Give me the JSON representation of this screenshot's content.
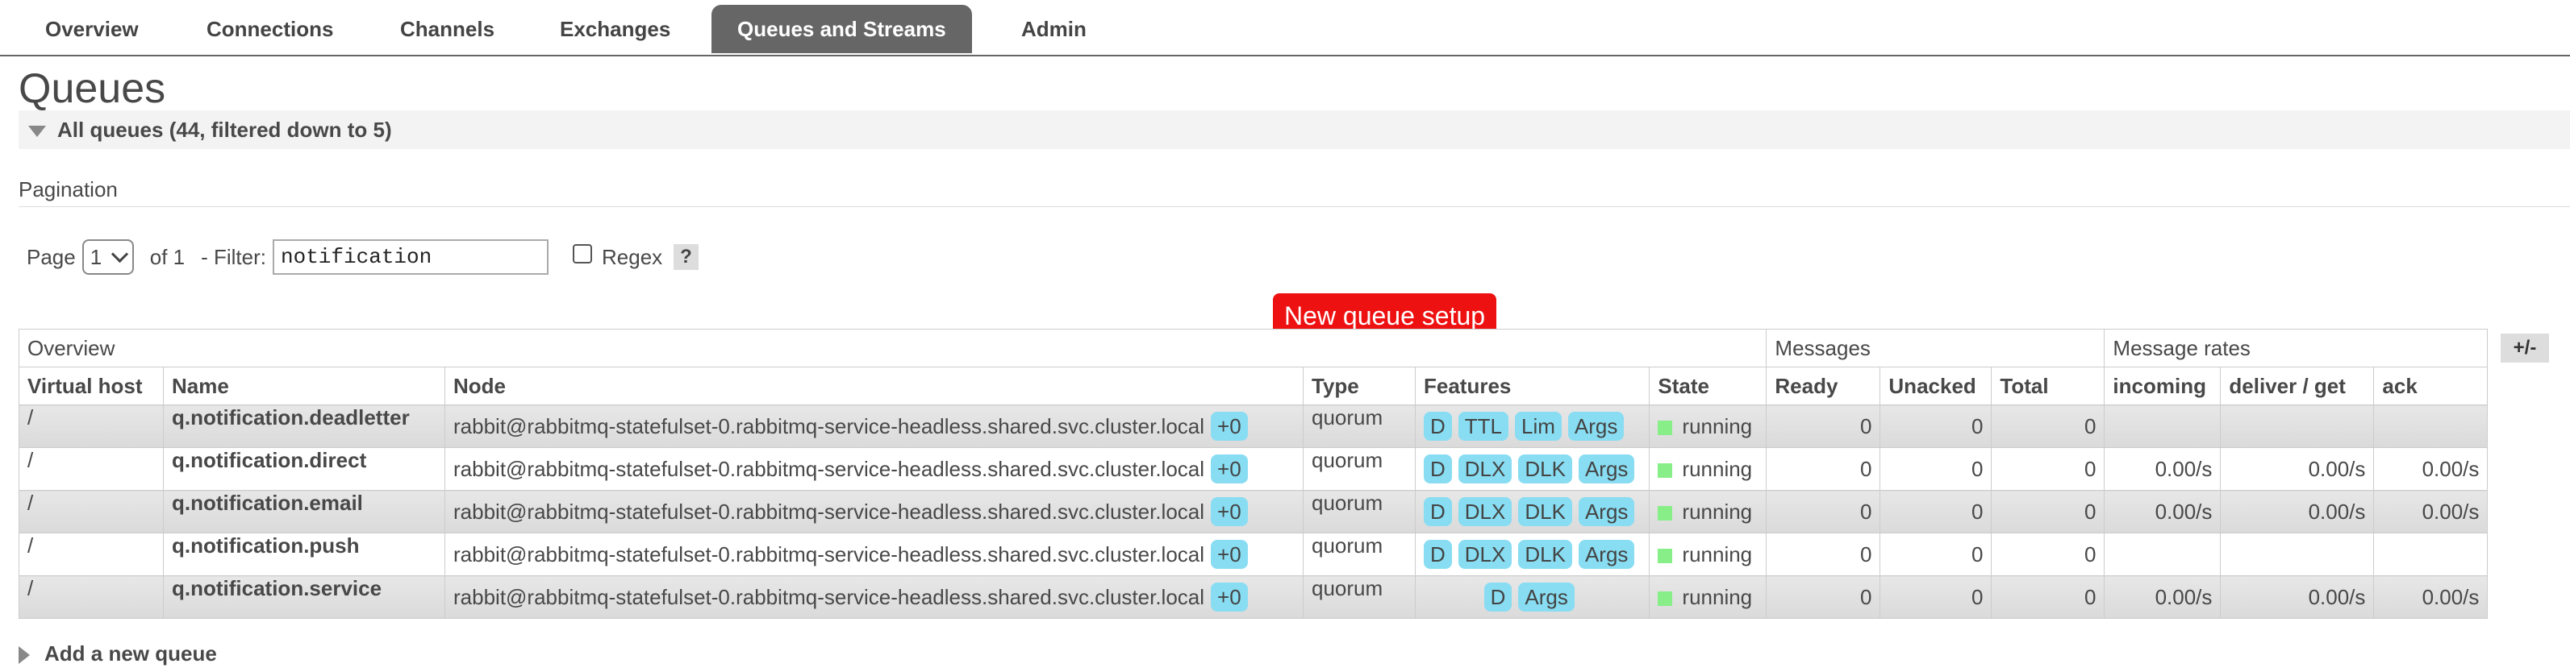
{
  "nav": {
    "tabs": [
      {
        "label": "Overview"
      },
      {
        "label": "Connections"
      },
      {
        "label": "Channels"
      },
      {
        "label": "Exchanges"
      },
      {
        "label": "Queues and Streams",
        "active": true
      },
      {
        "label": "Admin"
      }
    ]
  },
  "page_title": "Queues",
  "section": {
    "label": "All queues (44, filtered down to 5)"
  },
  "pagination": {
    "label": "Pagination",
    "page_prefix": "Page",
    "page_value": "1",
    "of_text": "of 1",
    "filter_label": "- Filter:",
    "filter_value": "notification",
    "regex_label": "Regex",
    "help_label": "?"
  },
  "callout": {
    "text": "New queue setup",
    "color": "#ee1111"
  },
  "toggle_columns_label": "+/-",
  "table": {
    "groups": {
      "overview": "Overview",
      "messages": "Messages",
      "rates": "Message rates"
    },
    "columns": {
      "vhost": "Virtual host",
      "name": "Name",
      "node": "Node",
      "type": "Type",
      "features": "Features",
      "state": "State",
      "ready": "Ready",
      "unacked": "Unacked",
      "total": "Total",
      "incoming": "incoming",
      "deliver": "deliver / get",
      "ack": "ack"
    },
    "rows": [
      {
        "vhost": "/",
        "name": "q.notification.deadletter",
        "node": "rabbit@rabbitmq-statefulset-0.rabbitmq-service-headless.shared.svc.cluster.local",
        "node_badge": "+0",
        "type": "quorum",
        "features": [
          "D",
          "TTL",
          "Lim",
          "Args"
        ],
        "state": "running",
        "ready": "0",
        "unacked": "0",
        "total": "0",
        "incoming": "",
        "deliver": "",
        "ack": ""
      },
      {
        "vhost": "/",
        "name": "q.notification.direct",
        "node": "rabbit@rabbitmq-statefulset-0.rabbitmq-service-headless.shared.svc.cluster.local",
        "node_badge": "+0",
        "type": "quorum",
        "features": [
          "D",
          "DLX",
          "DLK",
          "Args"
        ],
        "state": "running",
        "ready": "0",
        "unacked": "0",
        "total": "0",
        "incoming": "0.00/s",
        "deliver": "0.00/s",
        "ack": "0.00/s"
      },
      {
        "vhost": "/",
        "name": "q.notification.email",
        "node": "rabbit@rabbitmq-statefulset-0.rabbitmq-service-headless.shared.svc.cluster.local",
        "node_badge": "+0",
        "type": "quorum",
        "features": [
          "D",
          "DLX",
          "DLK",
          "Args"
        ],
        "state": "running",
        "ready": "0",
        "unacked": "0",
        "total": "0",
        "incoming": "0.00/s",
        "deliver": "0.00/s",
        "ack": "0.00/s"
      },
      {
        "vhost": "/",
        "name": "q.notification.push",
        "node": "rabbit@rabbitmq-statefulset-0.rabbitmq-service-headless.shared.svc.cluster.local",
        "node_badge": "+0",
        "type": "quorum",
        "features": [
          "D",
          "DLX",
          "DLK",
          "Args"
        ],
        "state": "running",
        "ready": "0",
        "unacked": "0",
        "total": "0",
        "incoming": "",
        "deliver": "",
        "ack": ""
      },
      {
        "vhost": "/",
        "name": "q.notification.service",
        "node": "rabbit@rabbitmq-statefulset-0.rabbitmq-service-headless.shared.svc.cluster.local",
        "node_badge": "+0",
        "type": "quorum",
        "features": [
          "D",
          "Args"
        ],
        "state": "running",
        "ready": "0",
        "unacked": "0",
        "total": "0",
        "incoming": "0.00/s",
        "deliver": "0.00/s",
        "ack": "0.00/s"
      }
    ]
  },
  "add_queue": {
    "label": "Add a new queue"
  },
  "colors": {
    "active_tab": "#666666",
    "feature_badge": "#88ddf2",
    "running": "#88ee88",
    "row_alt": "#e0e0e0"
  }
}
